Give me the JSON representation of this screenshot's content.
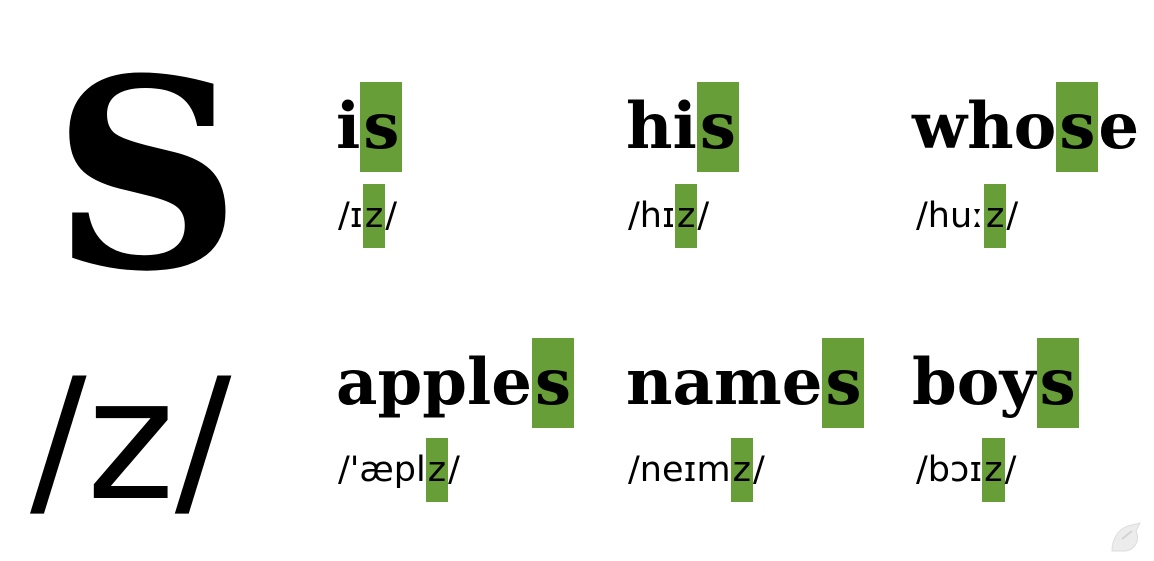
{
  "title": {
    "letter": "S",
    "ipa": "/z/"
  },
  "words": [
    {
      "stem": "i",
      "ending": "s",
      "ipa_pre": "/ɪ",
      "ipa_hl": "z",
      "ipa_post": "/"
    },
    {
      "stem": "hi",
      "ending": "s",
      "ipa_pre": "/hɪ",
      "ipa_hl": "z",
      "ipa_post": "/"
    },
    {
      "stem": "who",
      "ending": "s",
      "tail": "e",
      "ipa_pre": "/huː",
      "ipa_hl": "z",
      "ipa_post": "/"
    },
    {
      "stem": "apple",
      "ending": "s",
      "ipa_pre": "/'æpl",
      "ipa_hl": "z",
      "ipa_post": "/"
    },
    {
      "stem": "name",
      "ending": "s",
      "ipa_pre": "/neɪm",
      "ipa_hl": "z",
      "ipa_post": "/"
    },
    {
      "stem": "boy",
      "ending": "s",
      "ipa_pre": "/bɔɪ",
      "ipa_hl": "z",
      "ipa_post": "/"
    }
  ],
  "colors": {
    "highlight": "#689e38",
    "text": "#000000",
    "background": "#ffffff"
  },
  "icons": {
    "corner": "watermark-icon"
  }
}
